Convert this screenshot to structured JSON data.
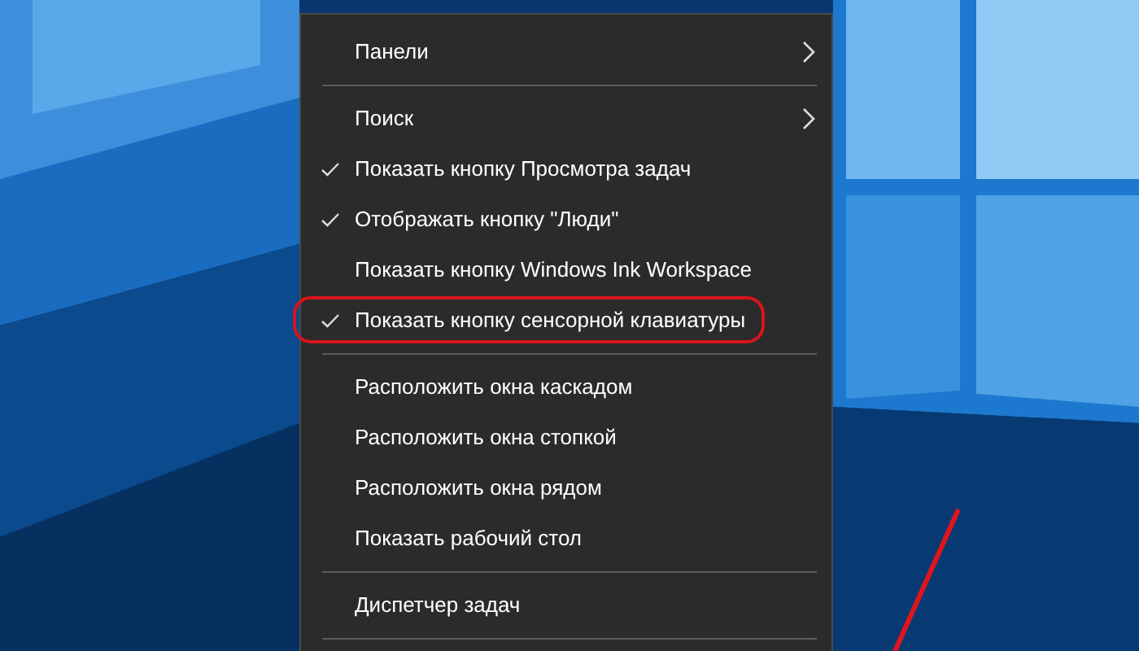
{
  "context_menu": {
    "items": [
      {
        "kind": "item",
        "label": "Панели",
        "checked": false,
        "submenu": true,
        "highlighted": false
      },
      {
        "kind": "separator"
      },
      {
        "kind": "item",
        "label": "Поиск",
        "checked": false,
        "submenu": true,
        "highlighted": false
      },
      {
        "kind": "item",
        "label": "Показать кнопку Просмотра задач",
        "checked": true,
        "submenu": false,
        "highlighted": false
      },
      {
        "kind": "item",
        "label": "Отображать кнопку \"Люди\"",
        "checked": true,
        "submenu": false,
        "highlighted": false
      },
      {
        "kind": "item",
        "label": "Показать кнопку Windows Ink Workspace",
        "checked": false,
        "submenu": false,
        "highlighted": false
      },
      {
        "kind": "item",
        "label": "Показать кнопку сенсорной клавиатуры",
        "checked": true,
        "submenu": false,
        "highlighted": true
      },
      {
        "kind": "separator"
      },
      {
        "kind": "item",
        "label": "Расположить окна каскадом",
        "checked": false,
        "submenu": false,
        "highlighted": false
      },
      {
        "kind": "item",
        "label": "Расположить окна стопкой",
        "checked": false,
        "submenu": false,
        "highlighted": false
      },
      {
        "kind": "item",
        "label": "Расположить окна рядом",
        "checked": false,
        "submenu": false,
        "highlighted": false
      },
      {
        "kind": "item",
        "label": "Показать рабочий стол",
        "checked": false,
        "submenu": false,
        "highlighted": false
      },
      {
        "kind": "separator"
      },
      {
        "kind": "item",
        "label": "Диспетчер задач",
        "checked": false,
        "submenu": false,
        "highlighted": false
      },
      {
        "kind": "separator"
      }
    ]
  }
}
